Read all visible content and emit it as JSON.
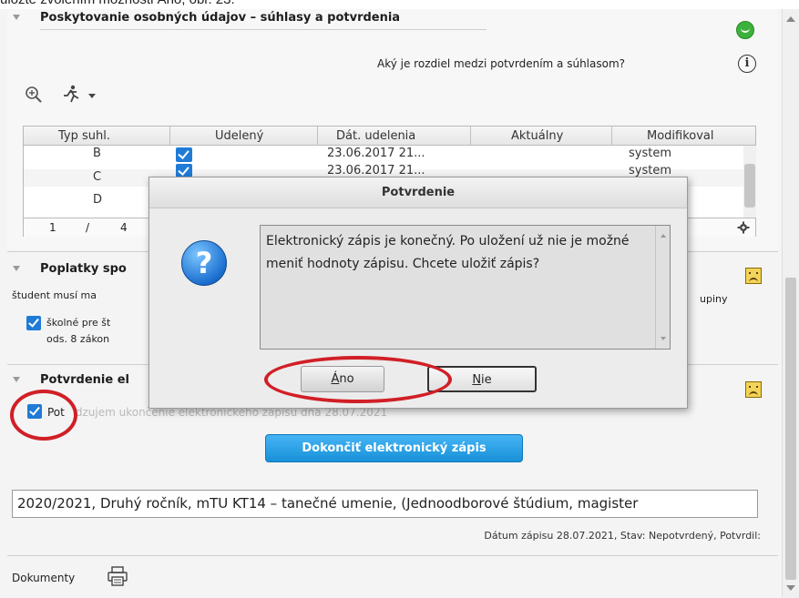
{
  "caption_fragment": "uložte zvolením možnosti Áno, obr. 23.",
  "consent_section": {
    "title": "Poskytovanie osobných údajov – súhlasy a potvrdenia",
    "help_question": "Aký je rozdiel medzi potvrdením a súhlasom?",
    "status_icon": "green-smiley-icon",
    "table": {
      "columns": [
        "Typ suhl.",
        "Udelený",
        "Dát. udelenia",
        "Aktuálny",
        "Modifikoval"
      ],
      "rows": [
        {
          "type": "B",
          "granted": true,
          "date": "23.06.2017 21...",
          "current": "",
          "modified_by": "system"
        },
        {
          "type": "C",
          "granted": true,
          "date": "23.06.2017 21...",
          "current": "",
          "modified_by": "system"
        },
        {
          "type": "D",
          "granted": false,
          "date": "",
          "current": "",
          "modified_by": ""
        }
      ],
      "pager": {
        "current": "1",
        "separator": "/",
        "total": "4"
      }
    }
  },
  "fees_section": {
    "title": "Poplatky spo",
    "line1": "študent musí ma",
    "line1_tail": "upiny",
    "item_line1": "školné pre št",
    "item_line2": "ods. 8 zákon"
  },
  "confirm_section": {
    "title": "Potvrdenie el",
    "checkbox_label_start": "Pot",
    "checkbox_label_end": "dzujem ukončenie elektronického zápisu dňa 28.07.2021",
    "finish_button": "Dokončiť elektronický zápis"
  },
  "study_field": "2020/2021, Druhý ročník, mTU KT14 – tanečné umenie, (Jednoodborové štúdium, magister",
  "enrollment_info": "Dátum zápisu 28.07.2021, Stav: Nepotvrdený, Potvrdil:",
  "documents_label": "Dokumenty",
  "dialog": {
    "title": "Potvrdenie",
    "message": "Elektronický zápis je konečný. Po uložení už nie je možné meniť hodnoty zápisu. Chcete uložiť zápis?",
    "yes_mnemonic": "Á",
    "yes_rest": "no",
    "no_mnemonic": "N",
    "no_rest": "ie"
  },
  "colors": {
    "accent_blue": "#1f7bd6",
    "annotation_red": "#d11f26",
    "finish_button": "#2ba3e8"
  }
}
